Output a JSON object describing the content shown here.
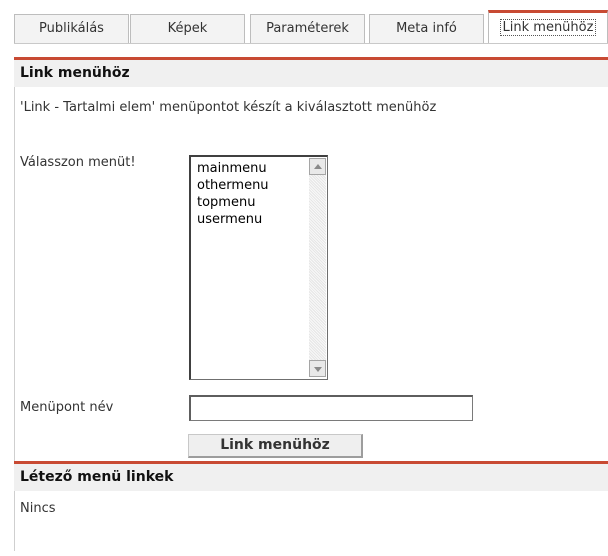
{
  "tabs": [
    {
      "label": "Publikálás",
      "active": false
    },
    {
      "label": "Képek",
      "active": false
    },
    {
      "label": "Paraméterek",
      "active": false
    },
    {
      "label": "Meta infó",
      "active": false
    },
    {
      "label": "Link menühöz",
      "active": true
    }
  ],
  "link_section": {
    "title": "Link menühöz",
    "description": "'Link - Tartalmi elem' menüpontot készít a kiválasztott menühöz",
    "menu_label": "Válasszon menüt!",
    "menus": [
      "mainmenu",
      "othermenu",
      "topmenu",
      "usermenu"
    ],
    "name_label": "Menüpont név",
    "name_value": "",
    "button_label": "Link menühöz"
  },
  "existing_section": {
    "title": "Létező menü linkek",
    "empty_text": "Nincs"
  },
  "colors": {
    "accent": "#c84a33",
    "header_bg": "#f0f0f0"
  }
}
